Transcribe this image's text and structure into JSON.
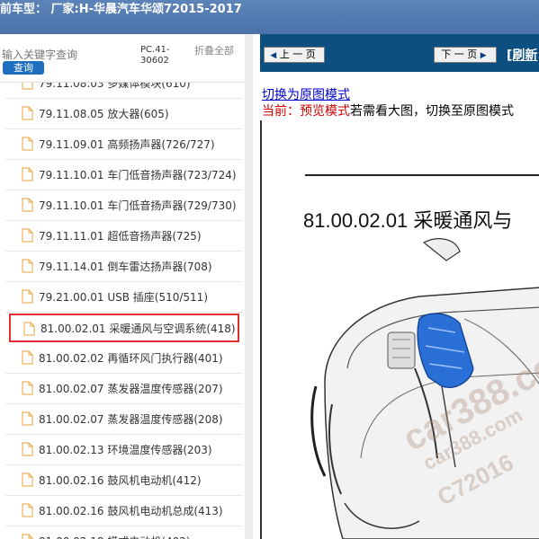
{
  "title": {
    "text": "前车型：  厂家:H-华晨汽车华颂72015-2017"
  },
  "sidebar": {
    "search_placeholder": "输入关键字查询",
    "search_button": "查询",
    "pc_code": "PC.41-30602",
    "collapse_all": "折叠全部",
    "items": [
      {
        "label": "79.11.08.03 多媒体模块(610)"
      },
      {
        "label": "79.11.08.05 放大器(605)"
      },
      {
        "label": "79.11.09.01 高频扬声器(726/727)"
      },
      {
        "label": "79.11.10.01 车门低音扬声器(723/724)"
      },
      {
        "label": "79.11.10.01 车门低音扬声器(729/730)"
      },
      {
        "label": "79.11.11.01 超低音扬声器(725)"
      },
      {
        "label": "79.11.14.01 倒车雷达扬声器(708)"
      },
      {
        "label": "79.21.00.01 USB 插座(510/511)"
      },
      {
        "label": "81.00.02.01 采暖通风与空调系统(418)"
      },
      {
        "label": "81.00.02.02 再循环风门执行器(401)"
      },
      {
        "label": "81.00.02.07 蒸发器温度传感器(207)"
      },
      {
        "label": "81.00.02.07 蒸发器温度传感器(208)"
      },
      {
        "label": "81.00.02.13 环境温度传感器(203)"
      },
      {
        "label": "81.00.02.16 鼓风机电动机(412)"
      },
      {
        "label": "81.00.02.16 鼓风机电动机总成(413)"
      },
      {
        "label": "81.00.02.18 模式电动机(402)"
      }
    ]
  },
  "viewer": {
    "prev_label": "上 一 页",
    "next_label": "下 一 页",
    "refresh_label": "[刷新",
    "switch_link": "切换为原图模式",
    "mode_prefix": "当前：",
    "mode_value": "预览模式",
    "mode_hint": "若需看大图，切换至原图模式",
    "doc_title": "81.00.02.01 采暖通风与",
    "watermark_1": "car388.co",
    "watermark_2": "car388.com",
    "watermark_3": "C72016",
    "accent_nav": "#0d4f80",
    "accent_blue": "#1e6fc0",
    "highlight_red": "#e03030"
  }
}
